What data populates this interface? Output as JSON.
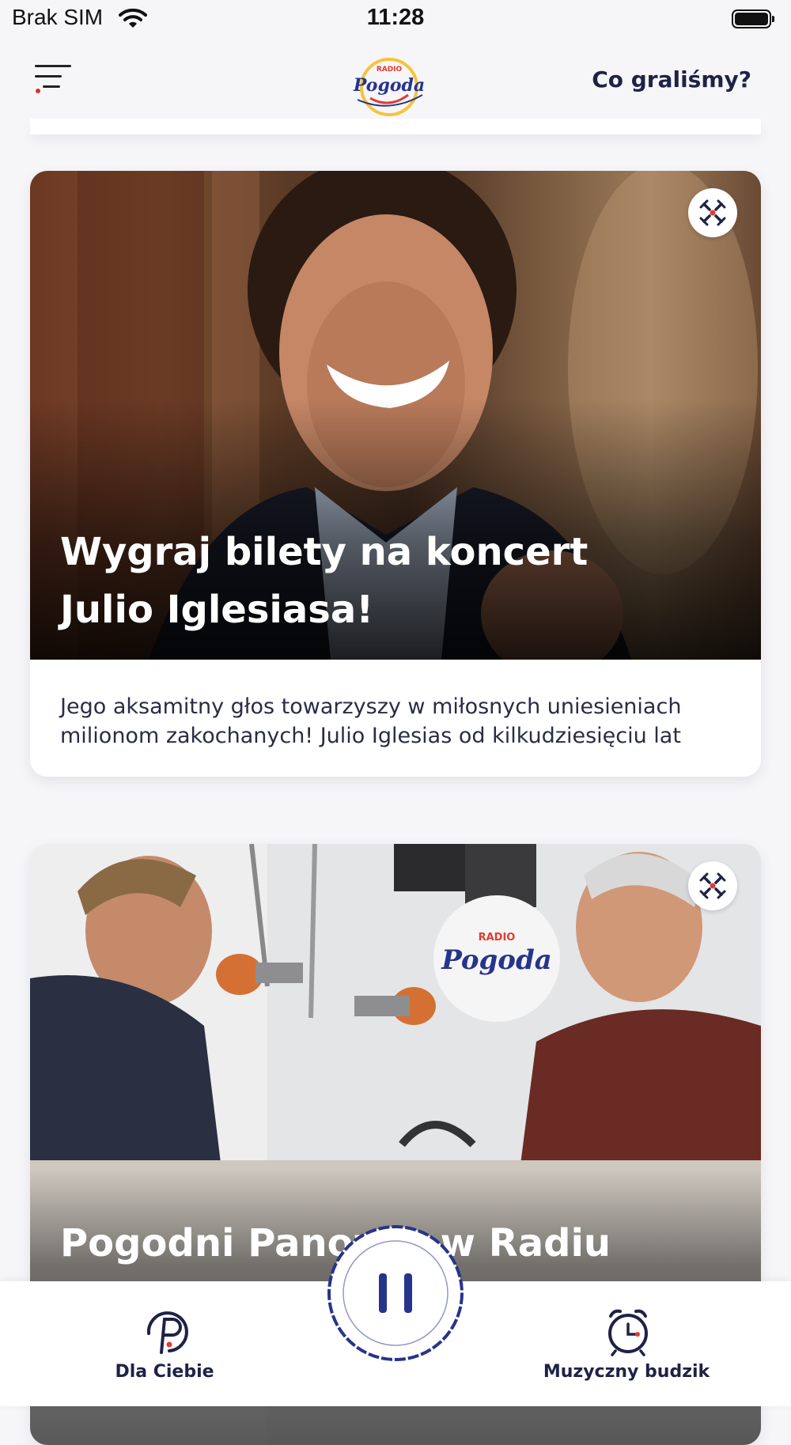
{
  "status_bar": {
    "carrier": "Brak SIM",
    "time": "11:28"
  },
  "header": {
    "logo_small": "RADIO",
    "logo": "Pogoda",
    "right_link": "Co graliśmy?"
  },
  "cards": [
    {
      "title": "Wygraj bilety na koncert Julio Iglesiasa!",
      "description": "Jego aksamitny głos towarzyszy w miłosnych uniesieniach milionom zakochanych! Julio Iglesias od kilkudziesięciu lat"
    },
    {
      "title": "Pogodni Panowie w Radiu Pogoda",
      "studio_logo_small": "RADIO",
      "studio_logo": "Pogoda"
    }
  ],
  "tab_bar": {
    "tabs": [
      {
        "label": "Dla Ciebie",
        "icon": "p-logo-icon"
      },
      {
        "label": "Muzyczny budzik",
        "icon": "alarm-clock-icon"
      }
    ],
    "player_state": "pause-icon"
  },
  "colors": {
    "brand_navy": "#27348b",
    "brand_red": "#e33b2f",
    "brand_yellow": "#f7c33c",
    "text_dark": "#1f2246"
  }
}
